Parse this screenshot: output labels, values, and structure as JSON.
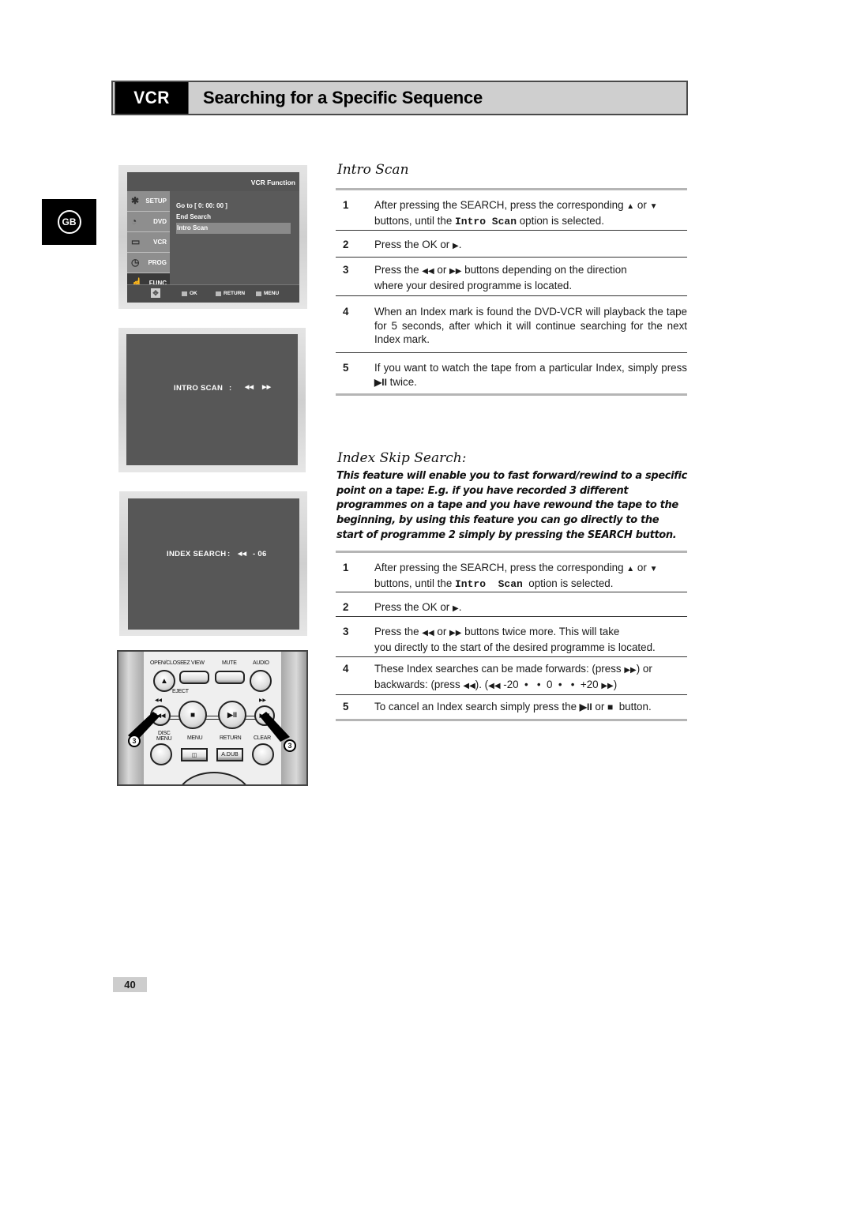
{
  "header": {
    "section_tag": "VCR",
    "title": "Searching for a Specific Sequence"
  },
  "language_tab": "GB",
  "menu_screen": {
    "title": "VCR Function",
    "sidebar": [
      {
        "label": "SETUP",
        "icon": "gear-icon",
        "active": false
      },
      {
        "label": "DVD",
        "icon": "dvd-icon",
        "active": false
      },
      {
        "label": "VCR",
        "icon": "vcr-icon",
        "active": false
      },
      {
        "label": "PROG",
        "icon": "clock-icon",
        "active": false
      },
      {
        "label": "FUNC",
        "icon": "hand-icon",
        "active": true
      }
    ],
    "options": [
      "Go to  [ 0: 00: 00 ]",
      "End Search",
      "Intro Scan"
    ],
    "selected_option": "Intro Scan",
    "bottom_bar": {
      "ok": "OK",
      "return": "RETURN",
      "menu": "MENU"
    }
  },
  "intro_screen": {
    "label": "INTRO SCAN",
    "separator": ":",
    "rew": "◀◀",
    "ff": "▶▶"
  },
  "index_screen": {
    "label": "INDEX SEARCH",
    "separator": ":",
    "rew": "◀◀",
    "value": "- 06"
  },
  "remote": {
    "labels": {
      "open_close": "OPEN/CLOSE",
      "ez_view": "EZ VIEW",
      "mute": "MUTE",
      "audio": "AUDIO",
      "eject": "EJECT",
      "rew": "◀◀",
      "ff": "▶▶",
      "disc_menu_1": "DISC",
      "disc_menu_2": "MENU",
      "menu": "MENU",
      "return": "RETURN",
      "clear": "CLEAR",
      "adub": "A.DUB",
      "stop": "■",
      "play_pause": "▶II",
      "prev": "I◀◀",
      "next": "▶▶I",
      "eject_sym": "▲"
    },
    "callouts": [
      "3",
      "3"
    ]
  },
  "intro_scan": {
    "heading": "Intro Scan",
    "steps": [
      {
        "n": "1",
        "a": "After pressing the SEARCH, press the corresponding ",
        "b": " or ",
        "c": "buttons, until the ",
        "code": "Intro Scan",
        "d": " option is selected."
      },
      {
        "n": "2",
        "a": "Press the OK or "
      },
      {
        "n": "3",
        "a": "Press the ",
        "b": " or ",
        "c": " buttons depending on the direction",
        "d": "where your desired programme is located."
      },
      {
        "n": "4",
        "a": "When an Index mark is found the DVD-VCR will playback the tape for 5 seconds, after which it will continue searching for the next Index mark."
      },
      {
        "n": "5",
        "a": "If you want to watch the tape from a particular Index, simply press ",
        "b": " twice."
      }
    ]
  },
  "index_skip": {
    "heading": "Index Skip Search:",
    "description": "This feature will enable you to fast forward/rewind to a specific point on a tape:  E.g. if you have recorded 3 different programmes on a tape and you have rewound the tape to the beginning, by using this feature you can go directly to the start of programme 2 simply by pressing the SEARCH button.",
    "steps": [
      {
        "n": "1",
        "a": "After pressing the SEARCH, press the corresponding ",
        "b": " or ",
        "c": "buttons, until the ",
        "code": "Intro  Scan",
        "d": "  option is selected."
      },
      {
        "n": "2",
        "a": "Press the OK or "
      },
      {
        "n": "3",
        "a": "Press the ",
        "b": " or ",
        "c": " buttons twice more. This will take",
        "d": "you directly to the start of the desired programme is located."
      },
      {
        "n": "4",
        "a": "These Index searches can be made forwards: (press ",
        "b": ") or",
        "c": "backwards: (press ",
        "d": "). (",
        "e": " -20  •   •  0  •   •  +20 ",
        "f": ")"
      },
      {
        "n": "5",
        "a": "To cancel an Index search simply press the ",
        "b": " or ",
        "c": "  button."
      }
    ]
  },
  "glyphs": {
    "up": "▲",
    "down": "▼",
    "right": "▶",
    "rew": "◀◀",
    "ff": "▶▶",
    "play_pause": "▶II",
    "stop": "■"
  },
  "page_number": "40"
}
